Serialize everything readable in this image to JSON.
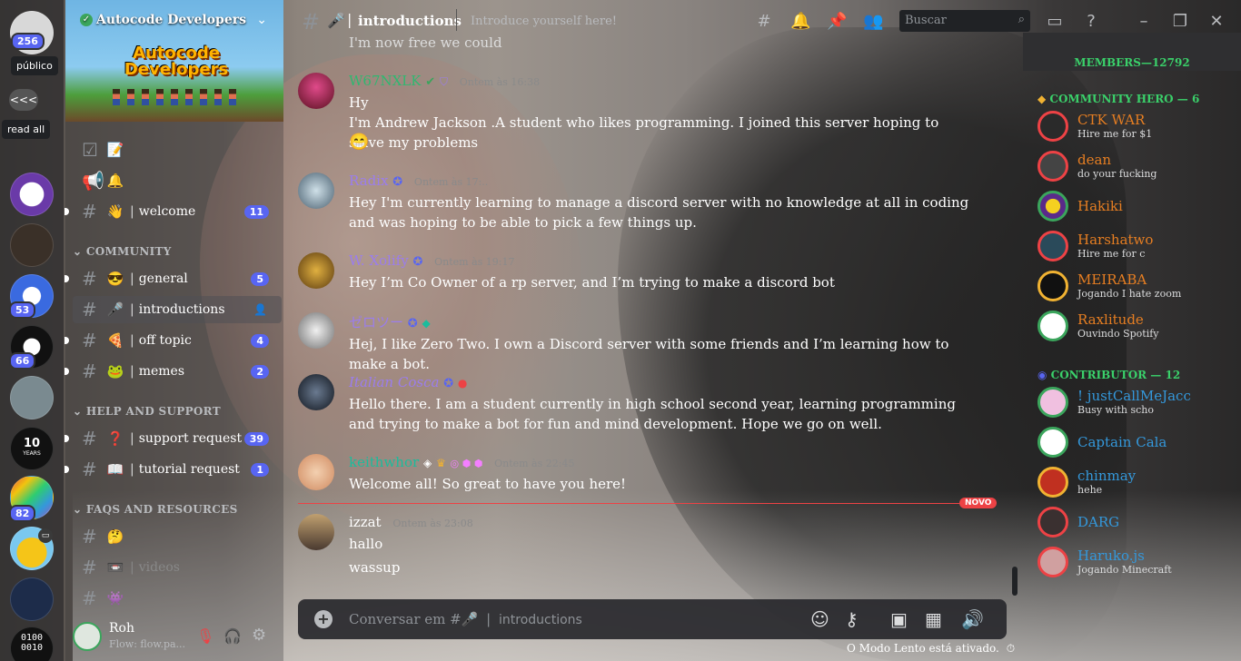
{
  "rail": {
    "notif_count": "256",
    "tooltip_public": "público",
    "back_label": "<<<",
    "tooltip_read_all": "read all",
    "badges": [
      "53",
      "66",
      "82"
    ],
    "year_label_top": "10",
    "year_label_bottom": "YEARS",
    "binary_top": "0100",
    "binary_bottom": "0010"
  },
  "server": {
    "name": "Autocode Developers",
    "banner_line1": "Autocode",
    "banner_line2": "Developers"
  },
  "channels": [
    {
      "emoji": "📝",
      "name": "",
      "count": ""
    },
    {
      "emoji": "🔔",
      "name": "",
      "count": ""
    },
    {
      "emoji": "👋",
      "name": "welcome",
      "count": "11"
    },
    {
      "emoji": "😎",
      "name": "general",
      "count": "5"
    },
    {
      "emoji": "🎤",
      "name": "introductions",
      "count": ""
    },
    {
      "emoji": "🍕",
      "name": "off topic",
      "count": "4"
    },
    {
      "emoji": "🐸",
      "name": "memes",
      "count": "2"
    },
    {
      "emoji": "❓",
      "name": "support request",
      "count": "39"
    },
    {
      "emoji": "📖",
      "name": "tutorial request",
      "count": "1"
    },
    {
      "emoji": "🤔",
      "name": "",
      "count": ""
    },
    {
      "emoji": "📼",
      "name": "videos",
      "count": ""
    },
    {
      "emoji": "👾",
      "name": "",
      "count": ""
    }
  ],
  "categories": {
    "community": "COMMUNITY",
    "help": "HELP AND SUPPORT",
    "faqs": "FAQS AND RESOURCES"
  },
  "user": {
    "name": "Roh",
    "status": "Flow: flow.pa..."
  },
  "header": {
    "channel_emoji": "🎤",
    "channel_name": "introductions",
    "topic": "Introduce yourself here!",
    "search_placeholder": "Buscar"
  },
  "messages": [
    {
      "text": "I'm now free we could"
    },
    {
      "author": "W67NXLK",
      "time": "Ontem às 16:38",
      "color": "#2fb870",
      "lines": [
        "Hy",
        "I'm Andrew Jackson .A student who likes programming. I joined this server hoping to solve my problems",
        "😁"
      ]
    },
    {
      "author": "Radix",
      "time": "Ontem às 17:..",
      "color": "#9b7ded",
      "lines": [
        "Hey I'm currently learning to manage a discord server with no knowledge at all in coding and was hoping to be able to pick a few things up."
      ]
    },
    {
      "author": "W. Xolify",
      "time": "Ontem às 19:17",
      "color": "#9b7ded",
      "lines": [
        "Hey I’m Co Owner of a rp server, and I’m trying to make a discord bot"
      ]
    },
    {
      "author": "ゼロツー",
      "time": "",
      "color": "#9b7ded",
      "lines": [
        "Hej, I like Zero Two. I own a Discord server with some friends and I’m learning how to make a bot."
      ]
    },
    {
      "author": "Italian Cosca",
      "time": "",
      "color": "#9b7ded",
      "lines": [
        "Hello there. I am a student currently in high school second year, learning programming and trying to make a bot for fun and mind development. Hope we go on well."
      ]
    },
    {
      "author": "keithwhor",
      "time": "Ontem às 22:45",
      "color": "#1abc9c",
      "lines": [
        "Welcome all! So great to have you here!"
      ]
    },
    {
      "author": "izzat",
      "time": "Ontem às 23:08",
      "color": "#ffffff",
      "lines": [
        "hallo",
        "wassup"
      ]
    }
  ],
  "new_label": "NOVO",
  "composer": {
    "placeholder_prefix": "Conversar em #🎤",
    "placeholder_channel": "introductions",
    "slowmode": "O Modo Lento está ativado."
  },
  "members": {
    "header": "MEMBERS—12792",
    "role_hero": "COMMUNITY HERO — 6",
    "role_contrib": "CONTRIBUTOR — 12",
    "heroes": [
      {
        "name": "CTK WAR",
        "status": "Hire me for $1",
        "color": "#e67e22"
      },
      {
        "name": "dean",
        "status": "do your fucking",
        "color": "#e67e22"
      },
      {
        "name": "Hakiki",
        "status": "",
        "color": "#e67e22"
      },
      {
        "name": "Harshatwo",
        "status": "Hire me for c",
        "color": "#e67e22"
      },
      {
        "name": "MEIRABA",
        "status": "Jogando I hate zoom",
        "color": "#e67e22"
      },
      {
        "name": "Raxlitude",
        "status": "Ouvindo Spotify",
        "color": "#e67e22"
      }
    ],
    "contributors": [
      {
        "name": "! justCallMeJacc",
        "status": "Busy with scho",
        "color": "#3498db"
      },
      {
        "name": "Captain Cala",
        "status": "",
        "color": "#3498db"
      },
      {
        "name": "chinmay",
        "status": "hehe",
        "color": "#3498db"
      },
      {
        "name": "DARG",
        "status": "",
        "color": "#3498db"
      },
      {
        "name": "Haruko.js",
        "status": "Jogando Minecraft",
        "color": "#3498db"
      }
    ]
  },
  "colors": {
    "accent": "#5865f2",
    "danger": "#ed4245",
    "online": "#3ba55c"
  }
}
